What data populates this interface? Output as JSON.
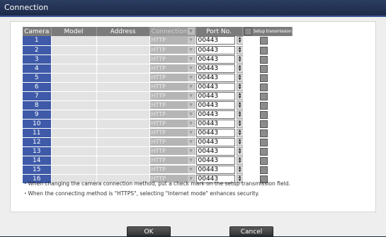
{
  "window": {
    "title": "Connection"
  },
  "table": {
    "headers": {
      "camera": "Camera",
      "model": "Model",
      "address": "Address",
      "connection": "Connection",
      "port": "Port No.",
      "setup": "Setup transmission"
    },
    "rows": [
      {
        "camera": "1",
        "connection": "HTTP",
        "port": "00443"
      },
      {
        "camera": "2",
        "connection": "HTTP",
        "port": "00443"
      },
      {
        "camera": "3",
        "connection": "HTTP",
        "port": "00443"
      },
      {
        "camera": "4",
        "connection": "HTTP",
        "port": "00443"
      },
      {
        "camera": "5",
        "connection": "HTTP",
        "port": "00443"
      },
      {
        "camera": "6",
        "connection": "HTTP",
        "port": "00443"
      },
      {
        "camera": "7",
        "connection": "HTTP",
        "port": "00443"
      },
      {
        "camera": "8",
        "connection": "HTTP",
        "port": "00443"
      },
      {
        "camera": "9",
        "connection": "HTTP",
        "port": "00443"
      },
      {
        "camera": "10",
        "connection": "HTTP",
        "port": "00443"
      },
      {
        "camera": "11",
        "connection": "HTTP",
        "port": "00443"
      },
      {
        "camera": "12",
        "connection": "HTTP",
        "port": "00443"
      },
      {
        "camera": "13",
        "connection": "HTTP",
        "port": "00443"
      },
      {
        "camera": "14",
        "connection": "HTTP",
        "port": "00443"
      },
      {
        "camera": "15",
        "connection": "HTTP",
        "port": "00443"
      },
      {
        "camera": "16",
        "connection": "HTTP",
        "port": "00443"
      }
    ]
  },
  "notes": [
    "・When changing the camera connection method, put a check mark on the setup transmission field.",
    "・When the connecting method is \"HTTPS\", selecting \"Internet mode\"  enhances security."
  ],
  "buttons": {
    "ok": "OK",
    "cancel": "Cancel"
  },
  "colors": {
    "titlebar": "#1d2a48",
    "camera_cell": "#3e5aa8",
    "header": "#7b7b7b",
    "button": "#343434"
  },
  "icons": {
    "dropdown": "chevron-down-icon",
    "spinner": "spinner-arrows-icon",
    "checkbox": "checkbox-icon"
  }
}
